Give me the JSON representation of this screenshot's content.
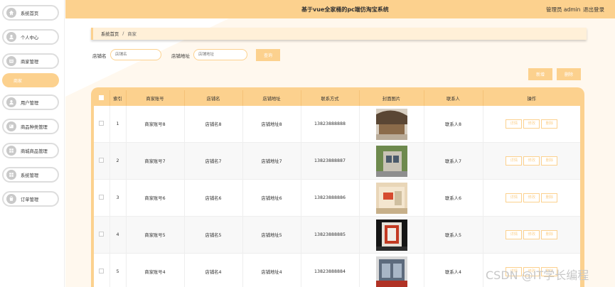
{
  "header": {
    "title": "基于vue全家桶的pc端仿淘宝系统",
    "admin": "管理员 admin",
    "logout": "退出登录"
  },
  "sidebar": {
    "items": [
      {
        "label": "系统首页",
        "icon": "home-icon"
      },
      {
        "label": "个人中心",
        "icon": "user-icon"
      },
      {
        "label": "商家管理",
        "icon": "shop-icon"
      },
      {
        "label": "用户管理",
        "icon": "user-icon"
      },
      {
        "label": "商品种类管理",
        "icon": "category-icon"
      },
      {
        "label": "商城商品管理",
        "icon": "grid-icon"
      },
      {
        "label": "系统管理",
        "icon": "grid-icon"
      },
      {
        "label": "订单管理",
        "icon": "order-icon"
      }
    ],
    "sub_item": "商家"
  },
  "breadcrumb": {
    "home": "系统首页",
    "separator": "/",
    "current": "商家"
  },
  "search": {
    "shop_name_label": "店铺名",
    "shop_name_placeholder": "店铺名",
    "shop_addr_label": "店铺地址",
    "shop_addr_placeholder": "店铺地址",
    "query_button": "查询"
  },
  "actions": {
    "add": "新增",
    "delete": "删除"
  },
  "table": {
    "headers": [
      "索引",
      "商家账号",
      "店铺名",
      "店铺地址",
      "联系方式",
      "封面图片",
      "联系人",
      "操作"
    ],
    "row_buttons": {
      "detail": "详情",
      "edit": "修改",
      "delete": "删除"
    },
    "rows": [
      {
        "index": "1",
        "account": "商家账号8",
        "shop": "店铺名8",
        "address": "店铺地址8",
        "phone": "13823888888",
        "contact": "联系人8"
      },
      {
        "index": "2",
        "account": "商家账号7",
        "shop": "店铺名7",
        "address": "店铺地址7",
        "phone": "13823888887",
        "contact": "联系人7"
      },
      {
        "index": "3",
        "account": "商家账号6",
        "shop": "店铺名6",
        "address": "店铺地址6",
        "phone": "13823888886",
        "contact": "联系人6"
      },
      {
        "index": "4",
        "account": "商家账号5",
        "shop": "店铺名5",
        "address": "店铺地址5",
        "phone": "13823888885",
        "contact": "联系人5"
      },
      {
        "index": "5",
        "account": "商家账号4",
        "shop": "店铺名4",
        "address": "店铺地址4",
        "phone": "13823888884",
        "contact": "联系人4"
      }
    ]
  },
  "watermark": "CSDN @IT学长编程",
  "colors": {
    "accent": "#fcd18e",
    "content_bg": "#fff8ee"
  }
}
